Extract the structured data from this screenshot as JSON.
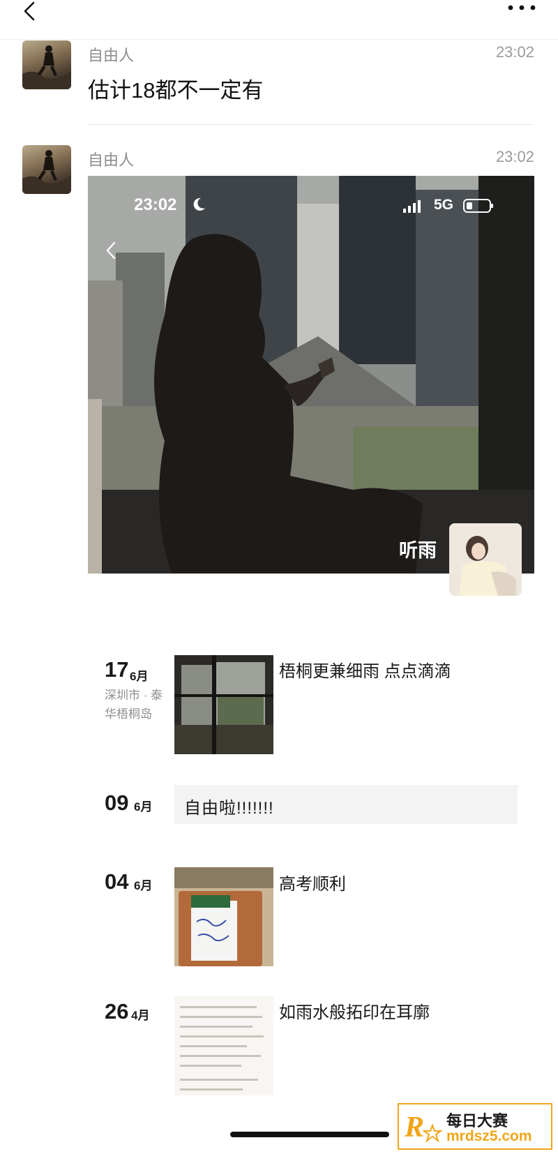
{
  "messages": [
    {
      "sender": "自由人",
      "time": "23:02",
      "text": "估计18都不一定有"
    },
    {
      "sender": "自由人",
      "time": "23:02",
      "screenshot": {
        "status_time": "23:02",
        "network": "5G",
        "profile_name": "听雨"
      }
    }
  ],
  "moments": [
    {
      "day": "17",
      "month": "6月",
      "location": "深圳市 · 泰华梧桐岛",
      "text": "梧桐更兼细雨 点点滴滴"
    },
    {
      "day": "09",
      "month": "6月",
      "text": "自由啦!!!!!!!"
    },
    {
      "day": "04",
      "month": "6月",
      "text": "高考顺利"
    },
    {
      "day": "26",
      "month": "4月",
      "text": "如雨水般拓印在耳廓"
    }
  ],
  "watermark": {
    "top": "每日大赛",
    "bottom": "mrdsz5.com"
  },
  "icons": [
    "back-icon",
    "more-icon",
    "moon-icon",
    "signal-icon",
    "battery-icon"
  ],
  "colors": {
    "accent": "#f1a51a",
    "muted": "#8c8c8c",
    "card": "#f3f3f3"
  }
}
